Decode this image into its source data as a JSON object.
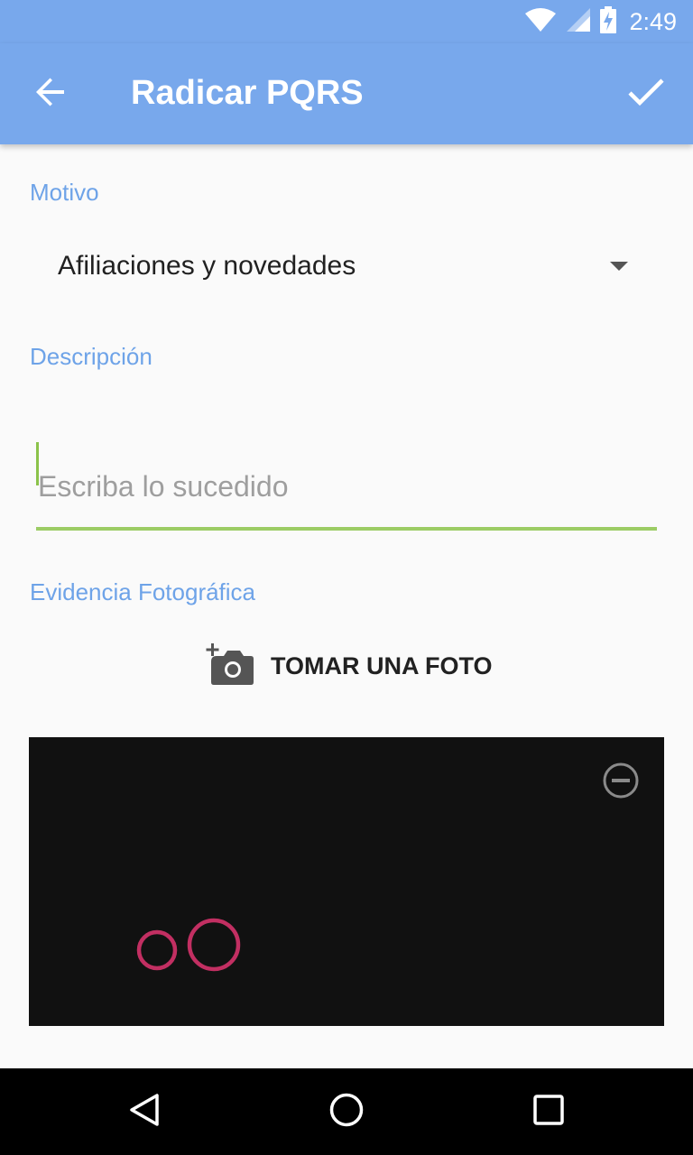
{
  "status_bar": {
    "time": "2:49",
    "icons": [
      "wifi-icon",
      "signal-icon",
      "battery-charging-icon"
    ]
  },
  "app_bar": {
    "title": "Radicar PQRS",
    "back_icon": "arrow-back-icon",
    "confirm_icon": "check-icon",
    "color": "#78a8ec"
  },
  "form": {
    "motivo": {
      "label": "Motivo",
      "selected": "Afiliaciones y novedades"
    },
    "descripcion": {
      "label": "Descripción",
      "value": "",
      "placeholder": "Escriba lo sucedido"
    },
    "evidencia": {
      "label": "Evidencia Fotográfica",
      "take_photo_label": "TOMAR UNA FOTO",
      "take_photo_icon": "add-photo-icon",
      "remove_icon": "remove-circle-icon"
    }
  },
  "colors": {
    "accent_label": "#6ea3e8",
    "focus_underline": "#9ccc65",
    "photo_ring": "#d6336c"
  },
  "nav_bar": {
    "icons": [
      "nav-back-icon",
      "nav-home-icon",
      "nav-recents-icon"
    ]
  }
}
